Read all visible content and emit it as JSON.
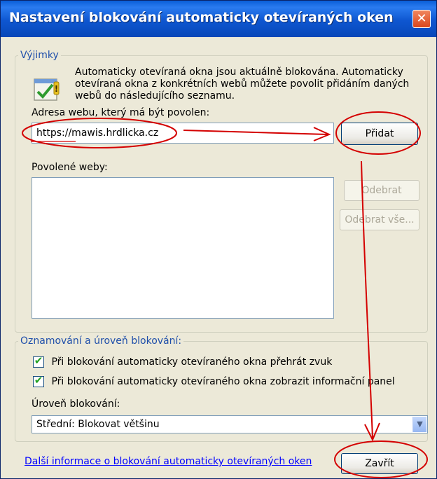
{
  "window": {
    "title": "Nastavení blokování automaticky otevíraných oken",
    "close_glyph": "✕"
  },
  "exceptions": {
    "legend": "Výjimky",
    "info_text": "Automaticky otevíraná okna jsou aktuálně blokována. Automaticky otevíraná okna z konkrétních webů můžete povolit přidáním daných webů do následujícího seznamu.",
    "info_icon": "shield-check-icon",
    "address_label": "Adresa webu, který má být povolen:",
    "address_value": "https://mawis.hrdlicka.cz",
    "add_button": "Přidat",
    "allowed_label": "Povolené weby:",
    "allowed_sites": [],
    "remove_button": "Odebrat",
    "remove_all_button": "Odebrat vše..."
  },
  "notifications": {
    "legend": "Oznamování a úroveň blokování:",
    "options": [
      {
        "label": "Při blokování automaticky otevíraného okna přehrát zvuk",
        "checked": true
      },
      {
        "label": "Při blokování automaticky otevíraného okna zobrazit informační panel",
        "checked": true
      }
    ],
    "level_label": "Úroveň blokování:",
    "level_value": "Střední: Blokovat většinu"
  },
  "footer": {
    "info_link": "Další informace o blokování automaticky otevíraných oken",
    "close_button": "Zavřít"
  },
  "annotation_color": "#D40000"
}
